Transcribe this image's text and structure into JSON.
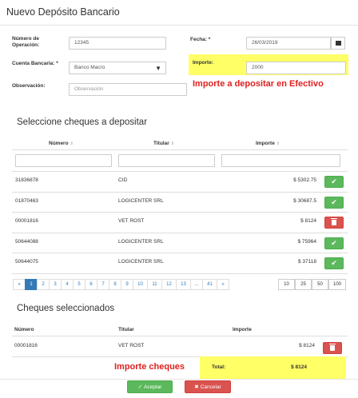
{
  "title": "Nuevo Depósito Bancario",
  "form": {
    "numero_label": "Número de Operación:",
    "numero_value": "12345",
    "fecha_label": "Fecha: *",
    "fecha_value": "26/03/2019",
    "cuenta_label": "Cuenta Bancaria: *",
    "cuenta_value": "Banco Macro",
    "importe_label": "Importe:",
    "importe_value": "2000",
    "observacion_label": "Observación:",
    "observacion_placeholder": "Observación"
  },
  "notes": {
    "efectivo": "Importe a depositar en Efectivo",
    "cheques": "Importe cheques"
  },
  "cheques_table": {
    "section_title": "Seleccione cheques a depositar",
    "headers": [
      "Número",
      "Titular",
      "Importe"
    ],
    "rows": [
      {
        "numero": "31836878",
        "titular": "CID",
        "importe": "$ 5302.75",
        "action": "add"
      },
      {
        "numero": "01870463",
        "titular": "LOGICENTER SRL",
        "importe": "$ 30687.5",
        "action": "add"
      },
      {
        "numero": "00001816",
        "titular": "VET ROST",
        "importe": "$ 8124",
        "action": "remove"
      },
      {
        "numero": "50644088",
        "titular": "LOGICENTER SRL",
        "importe": "$ 75964",
        "action": "add"
      },
      {
        "numero": "50644075",
        "titular": "LOGICENTER SRL",
        "importe": "$ 37118",
        "action": "add"
      }
    ]
  },
  "pagination": {
    "prev": "«",
    "pages": [
      "1",
      "2",
      "3",
      "4",
      "5",
      "6",
      "7",
      "8",
      "9",
      "10",
      "11",
      "12",
      "13",
      "...",
      "41"
    ],
    "next": "»",
    "active": "1",
    "page_sizes": [
      "10",
      "25",
      "50",
      "100"
    ]
  },
  "selected_table": {
    "section_title": "Cheques seleccionados",
    "headers": [
      "Número",
      "Titular",
      "Importe"
    ],
    "rows": [
      {
        "numero": "00001816",
        "titular": "VET ROST",
        "importe": "$ 8124"
      }
    ],
    "total_label": "Total:",
    "total_value": "$ 8124"
  },
  "actions": {
    "accept": "Aceptar",
    "cancel": "Cancelar"
  },
  "icons": {
    "add": "check-icon",
    "remove": "trash-icon",
    "calendar": "calendar-icon",
    "dropdown": "caret-down-icon"
  },
  "colors": {
    "success": "#5cb85c",
    "danger": "#d9534f",
    "highlight": "#ffff66",
    "note": "#e02020",
    "pagination_active": "#337ab7"
  }
}
